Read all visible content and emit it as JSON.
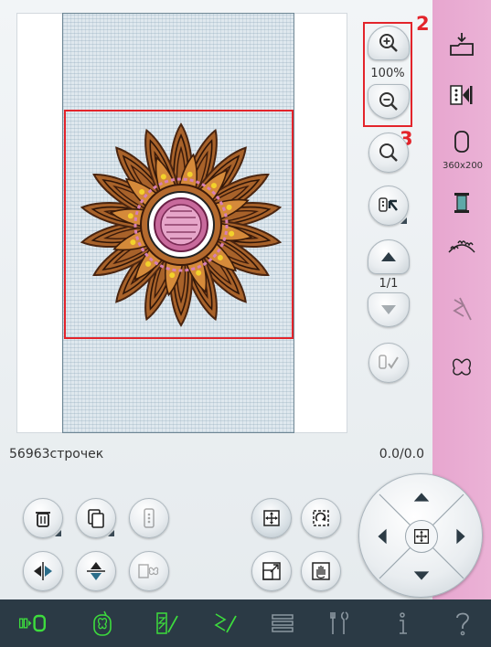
{
  "zoom": {
    "level": "100%"
  },
  "callouts": {
    "zoom_group": "2",
    "zoom_all": "3"
  },
  "side": {
    "hoop_label": "360x200"
  },
  "status": {
    "stitch_count": "56963строчек",
    "coords": "0.0/0.0"
  },
  "pagination": {
    "text": "1/1"
  },
  "colors": {
    "selection": "#e3242b",
    "side_panel": "#e8a9d1",
    "toolbar": "#2b3a45",
    "active": "#3ddc3d"
  }
}
